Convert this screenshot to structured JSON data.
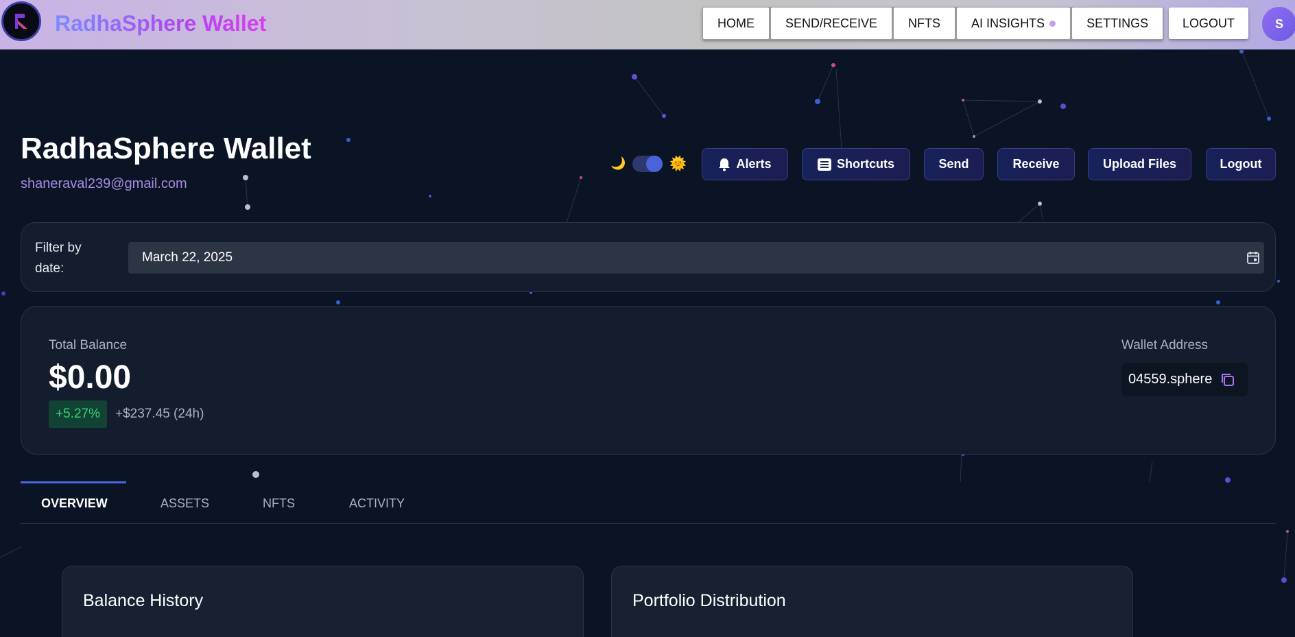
{
  "topnav": {
    "brand": "RadhaSphere Wallet",
    "items": [
      {
        "label": "HOME"
      },
      {
        "label": "SEND/RECEIVE"
      },
      {
        "label": "NFTS"
      },
      {
        "label": "AI INSIGHTS"
      },
      {
        "label": "SETTINGS"
      }
    ],
    "logout_label": "LOGOUT",
    "avatar_initial": "S"
  },
  "header": {
    "title": "RadhaSphere Wallet",
    "email": "shaneraval239@gmail.com",
    "theme_toggle": {
      "moon_icon": "🌙",
      "sun_icon": "🌞",
      "state": "on"
    },
    "actions": [
      {
        "label": "Alerts",
        "icon": "bell-icon"
      },
      {
        "label": "Shortcuts",
        "icon": "keyboard-icon"
      },
      {
        "label": "Send"
      },
      {
        "label": "Receive"
      },
      {
        "label": "Upload Files"
      },
      {
        "label": "Logout"
      }
    ]
  },
  "filter": {
    "label": "Filter by date:",
    "value": "March 22, 2025"
  },
  "balance": {
    "label": "Total Balance",
    "value": "$0.00",
    "change_pct": "+5.27%",
    "change_abs": "+$237.45 (24h)",
    "address_label": "Wallet Address",
    "address": "04559.sphere"
  },
  "tabs": [
    {
      "label": "OVERVIEW",
      "active": true
    },
    {
      "label": "ASSETS"
    },
    {
      "label": "NFTS"
    },
    {
      "label": "ACTIVITY"
    }
  ],
  "panels": {
    "balance_history": "Balance History",
    "portfolio_distribution": "Portfolio Distribution"
  },
  "colors": {
    "background": "#0b1424",
    "accent": "#4c68e0",
    "email": "#a78be0",
    "positive": "#2ed67a"
  }
}
